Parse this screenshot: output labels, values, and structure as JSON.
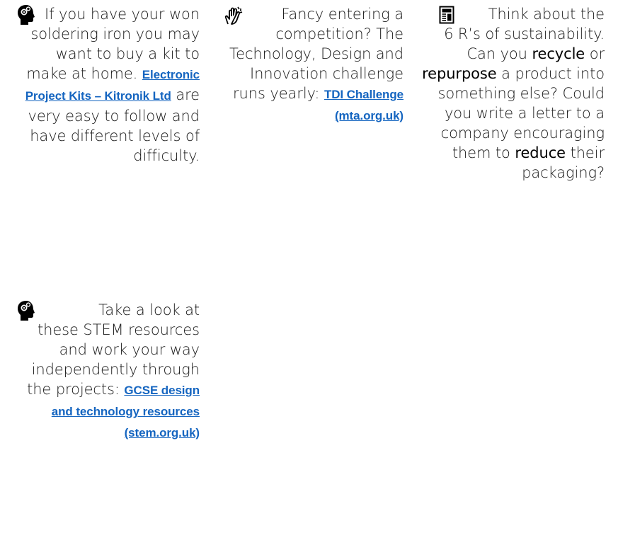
{
  "cards": [
    {
      "id": "card-soldering-kits",
      "icon": "head-gears-icon",
      "text_before": "If you have your won soldering iron you may want to buy a kit to make at home.",
      "link": "Electronic Project Kits – Kitronik Ltd",
      "text_after": "are very easy to follow and have different levels of difficulty."
    },
    {
      "id": "card-competition",
      "icon": "sign-language-hand-icon",
      "text_before": "Fancy entering a competition? The Technology, Design and Innovation challenge runs yearly:",
      "link": "TDI Challenge (mta.org.uk)"
    },
    {
      "id": "card-sustainability",
      "icon": "newspaper-icon",
      "text_1": "Think about the 6 R’s of sustainability. Can you",
      "word_recycle": "recycle",
      "text_2": "or",
      "word_repurpose": "repurpose",
      "text_3": "a product into something else? Could you write a letter to a company encouraging them to",
      "word_reduce": "reduce",
      "text_4": "their packaging?"
    },
    {
      "id": "card-stem-resources",
      "icon": "head-gears-icon",
      "text_before": "Take a look at these STEM resources and work your way independently through the projects:",
      "link": "GCSE design and technology resources (stem.org.uk)"
    }
  ],
  "colors": {
    "link": "#1565c0",
    "text": "#1a1a1a"
  }
}
